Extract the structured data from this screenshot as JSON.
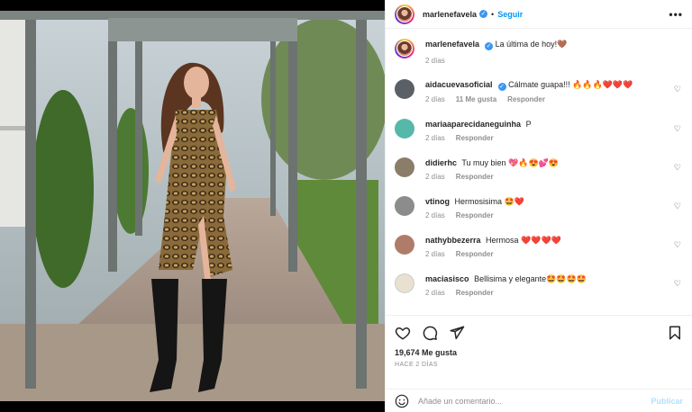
{
  "post": {
    "username": "marlenefavela",
    "follow_label": "Seguir",
    "more_label": "•••",
    "caption_text": "La última de hoy!🤎",
    "caption_time": "2 días",
    "likes": "19,674 Me gusta",
    "posted_ago": "HACE 2 DÍAS"
  },
  "comments": [
    {
      "user": "aidacuevasoficial",
      "verified": true,
      "text": "Cálmate guapa!!! 🔥🔥🔥❤️❤️❤️",
      "time": "2 días",
      "likes": "11 Me gusta",
      "reply": "Responder",
      "avatar_color": "#5b5f66"
    },
    {
      "user": "mariaaparecidaneguinha",
      "verified": false,
      "text": "P",
      "time": "2 días",
      "likes": "",
      "reply": "Responder",
      "avatar_color": "#56b8a8"
    },
    {
      "user": "didierhc",
      "verified": false,
      "text": "Tu muy bien 💖🔥😍💕😍",
      "time": "2 días",
      "likes": "",
      "reply": "Responder",
      "avatar_color": "#8a7d6a"
    },
    {
      "user": "vtinog",
      "verified": false,
      "text": "Hermosisima 🤩❤️",
      "time": "2 días",
      "likes": "",
      "reply": "Responder",
      "avatar_color": "#8c8c8c"
    },
    {
      "user": "nathybbezerra",
      "verified": false,
      "text": "Hermosa ❤️❤️❤️❤️",
      "time": "2 días",
      "likes": "",
      "reply": "Responder",
      "avatar_color": "#b07c6a"
    },
    {
      "user": "maciasisco",
      "verified": false,
      "text": "Bellisima y elegante🤩🤩🤩🤩",
      "time": "2 días",
      "likes": "",
      "reply": "Responder",
      "avatar_color": "#e8e0d0"
    }
  ],
  "composer": {
    "placeholder": "Añade un comentario...",
    "post_label": "Publicar"
  },
  "icons": {
    "like": "heart-outline-icon",
    "comment": "comment-bubble-icon",
    "share": "paper-plane-icon",
    "save": "bookmark-icon",
    "emoji": "smiley-icon",
    "verified": "verified-badge-icon"
  },
  "colors": {
    "accent": "#0095f6",
    "verified": "#3897f0",
    "muted": "#8e8e8e",
    "post_disabled": "#b2dffc"
  }
}
